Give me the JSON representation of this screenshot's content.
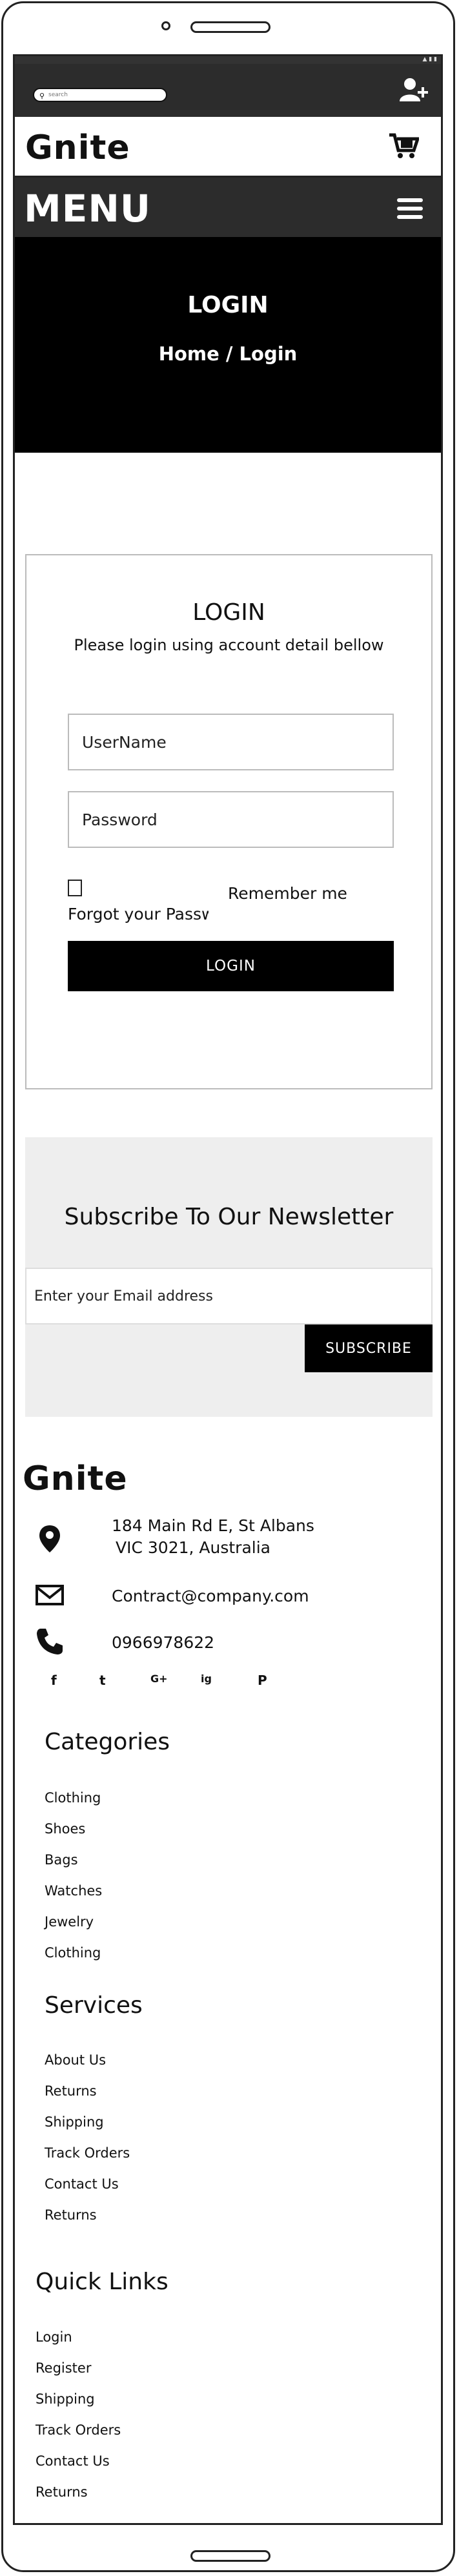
{
  "search": {
    "placeholder": "search"
  },
  "header": {
    "brand": "Gnite",
    "menu_label": "MENU"
  },
  "hero": {
    "title": "LOGIN",
    "breadcrumb": "Home / Login"
  },
  "login": {
    "heading": "LOGIN",
    "subtitle": "Please login using account detail bellow",
    "username_placeholder": "UserName",
    "password_placeholder": "Password",
    "remember_label": "Remember me",
    "forgot_label": "Forgot your Password?",
    "button_label": "LOGIN"
  },
  "newsletter": {
    "heading": "Subscribe To Our Newsletter",
    "email_placeholder": "Enter your Email address",
    "button_label": "SUBSCRIBE"
  },
  "footer": {
    "brand": "Gnite",
    "address_line1": "184 Main Rd E, St Albans",
    "address_line2": "VIC 3021, Australia",
    "email": "Contract@company.com",
    "phone": "0966978622",
    "social": [
      "f",
      "t",
      "G+",
      "ig",
      "P"
    ],
    "categories": {
      "heading": "Categories",
      "items": [
        "Clothing",
        "Shoes",
        "Bags",
        "Watches",
        "Jewelry",
        "Clothing"
      ]
    },
    "services": {
      "heading": "Services",
      "items": [
        "About Us",
        "Returns",
        "Shipping",
        "Track Orders",
        "Contact Us",
        "Returns"
      ]
    },
    "quick_links": {
      "heading": "Quick Links",
      "items": [
        "Login",
        "Register",
        "Shipping",
        "Track Orders",
        "Contact Us",
        "Returns"
      ]
    }
  }
}
